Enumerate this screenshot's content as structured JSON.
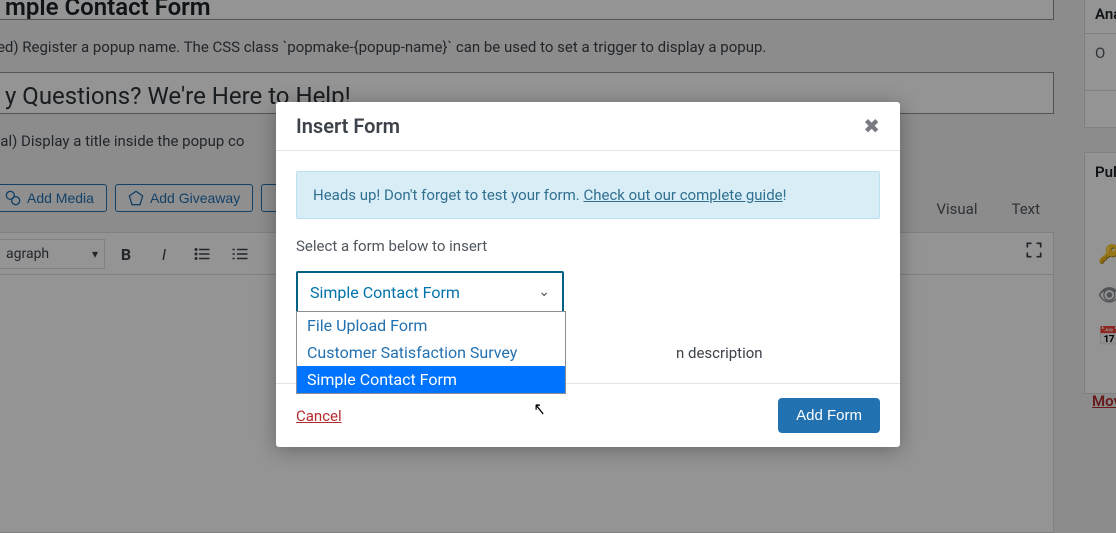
{
  "bg": {
    "title": "mple Contact Form",
    "caption1": "red) Register a popup name. The CSS class `popmake-{popup-name}` can be used to set a trigger to display a popup.",
    "subtitle": "y Questions? We're Here to Help!",
    "caption2": "nal) Display a title inside the popup co",
    "add_media": "Add Media",
    "add_giveaway": "Add Giveaway",
    "paragraph": "agraph",
    "tab_visual": "Visual",
    "tab_text": "Text",
    "side_ana": "Ana",
    "side_o": "O",
    "side_pub": "Pul",
    "side_move": "Mov"
  },
  "modal": {
    "title": "Insert Form",
    "info_prefix": "Heads up! Don't forget to test your form. ",
    "info_link": "Check out our complete guide",
    "info_suffix": "!",
    "select_label": "Select a form below to insert",
    "selected": "Simple Contact Form",
    "options": [
      "File Upload Form",
      "Customer Satisfaction Survey",
      "Simple Contact Form"
    ],
    "highlight_index": 2,
    "extra_text": "n description",
    "cancel": "Cancel",
    "add": "Add Form"
  }
}
